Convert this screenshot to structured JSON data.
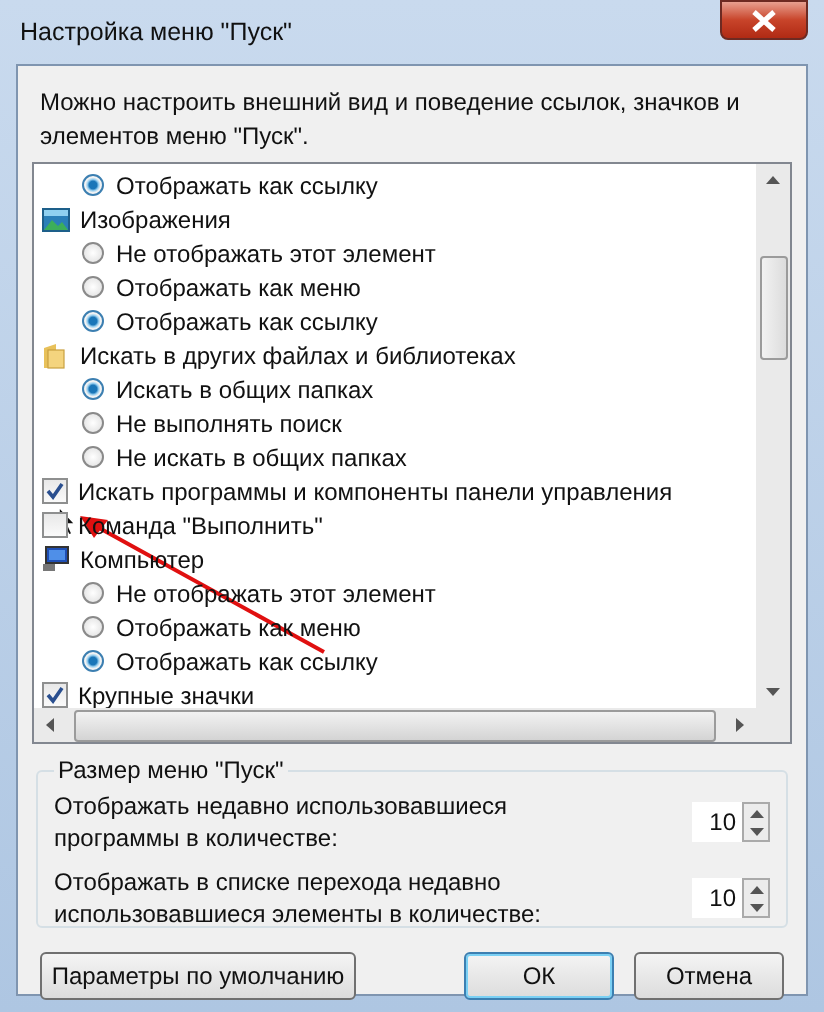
{
  "window": {
    "title": "Настройка меню \"Пуск\""
  },
  "description": "Можно настроить внешний вид и поведение ссылок, значков и элементов меню \"Пуск\".",
  "items": [
    {
      "kind": "radio",
      "label": "Отображать как ссылку",
      "selected": true
    },
    {
      "kind": "heading",
      "label": "Изображения",
      "children": [
        {
          "kind": "radio",
          "label": "Не отображать этот элемент",
          "selected": false
        },
        {
          "kind": "radio",
          "label": "Отображать как меню",
          "selected": false
        },
        {
          "kind": "radio",
          "label": "Отображать как ссылку",
          "selected": true
        }
      ]
    },
    {
      "kind": "heading",
      "label": "Искать в других файлах и библиотеках",
      "children": [
        {
          "kind": "radio",
          "label": "Искать в общих папках",
          "selected": true
        },
        {
          "kind": "radio",
          "label": "Не выполнять поиск",
          "selected": false
        },
        {
          "kind": "radio",
          "label": "Не искать в общих папках",
          "selected": false
        }
      ]
    },
    {
      "kind": "checkbox",
      "label": "Искать программы и компоненты панели управления",
      "checked": true
    },
    {
      "kind": "checkbox",
      "label": "Команда \"Выполнить\"",
      "checked": false
    },
    {
      "kind": "heading",
      "label": "Компьютер",
      "children": [
        {
          "kind": "radio",
          "label": "Не отображать этот элемент",
          "selected": false
        },
        {
          "kind": "radio",
          "label": "Отображать как меню",
          "selected": false
        },
        {
          "kind": "radio",
          "label": "Отображать как ссылку",
          "selected": true
        }
      ]
    },
    {
      "kind": "checkbox",
      "label": "Крупные значки",
      "checked": true
    }
  ],
  "size_group": {
    "legend": "Размер меню \"Пуск\"",
    "rows": [
      {
        "label": "Отображать недавно использовавшиеся программы в количестве:",
        "value": "10"
      },
      {
        "label": "Отображать в списке перехода недавно использовавшиеся элементы в количестве:",
        "value": "10"
      }
    ]
  },
  "buttons": [
    {
      "label": "Параметры по умолчанию",
      "default": false
    },
    {
      "label": "ОК",
      "default": true
    },
    {
      "label": "Отмена",
      "default": false
    }
  ]
}
